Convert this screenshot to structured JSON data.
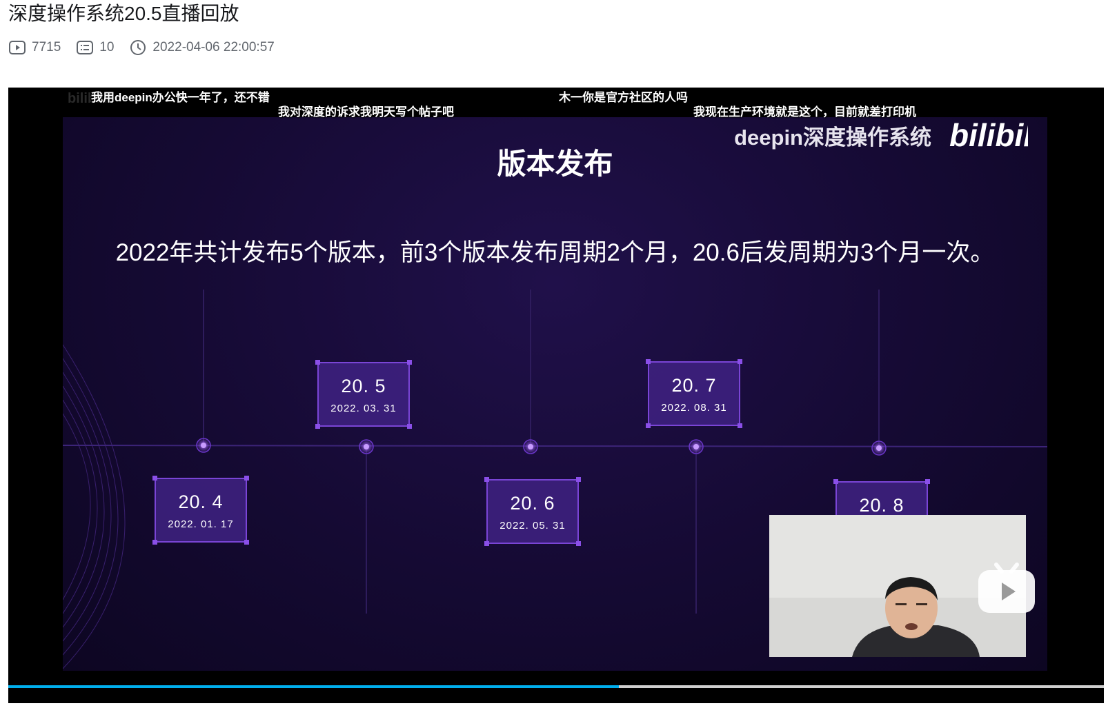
{
  "video": {
    "title": "深度操作系统20.5直播回放",
    "views": "7715",
    "comments": "10",
    "publish_time": "2022-04-06 22:00:57",
    "progress": 0.557
  },
  "danmaku": [
    "我用deepin办公快一年了，还不错",
    "我对深度的诉求我明天写个帖子吧",
    "木一你是官方社区的人吗",
    "我现在生产环境就是这个，目前就差打印机"
  ],
  "slide": {
    "brand": "deepin深度操作系统",
    "title": "版本发布",
    "subtitle": "2022年共计发布5个版本，前3个版本发布周期2个月，20.6后发周期为3个月一次。",
    "versions": [
      {
        "version": "20. 4",
        "date": "2022. 01. 17"
      },
      {
        "version": "20. 5",
        "date": "2022. 03. 31"
      },
      {
        "version": "20. 6",
        "date": "2022. 05. 31"
      },
      {
        "version": "20. 7",
        "date": "2022. 08. 31"
      },
      {
        "version": "20. 8",
        "date": ""
      }
    ]
  },
  "icons": {
    "views": "play-count-icon",
    "comments": "danmaku-count-icon",
    "time": "clock-icon",
    "play": "play-button-icon",
    "watermark": "bilibili-logo"
  },
  "colors": {
    "accent": "#00aeec",
    "slide_bg": "#150a33",
    "version_box": "#7a45d6"
  }
}
